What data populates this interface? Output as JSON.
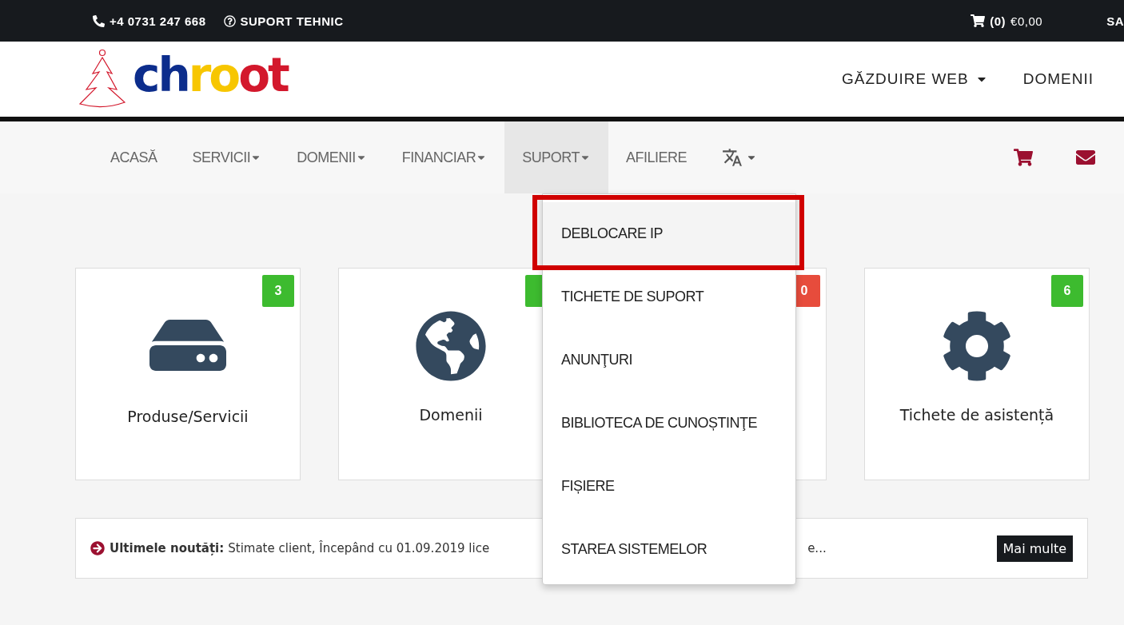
{
  "top_bar": {
    "phone": "+4 0731 247 668",
    "support": "SUPORT TEHNIC",
    "cart_count": "(0)",
    "cart_total": "€0,00",
    "cut_text": "SA"
  },
  "header": {
    "logo": [
      {
        "text": "ch",
        "color": "#0c2d8c"
      },
      {
        "text": "ro",
        "color": "#f7c600"
      },
      {
        "text": "ot",
        "color": "#d3182c"
      }
    ],
    "menu": [
      {
        "label": "GĂZDUIRE WEB",
        "dropdown": true
      },
      {
        "label": "DOMENII",
        "dropdown": false
      }
    ]
  },
  "nav": {
    "items": [
      {
        "label": "ACASĂ",
        "dropdown": false,
        "selected": false
      },
      {
        "label": "SERVICII",
        "dropdown": true,
        "selected": false
      },
      {
        "label": "DOMENII",
        "dropdown": true,
        "selected": false
      },
      {
        "label": "FINANCIAR",
        "dropdown": true,
        "selected": false
      },
      {
        "label": "SUPORT",
        "dropdown": true,
        "selected": true
      },
      {
        "label": "AFILIERE",
        "dropdown": false,
        "selected": false
      }
    ]
  },
  "dropdown": {
    "items": [
      {
        "label": "DEBLOCARE IP",
        "highlighted": true
      },
      {
        "label": "TICHETE DE SUPORT",
        "highlighted": false
      },
      {
        "label": "ANUNŢURI",
        "highlighted": false
      },
      {
        "label": "BIBLIOTECA DE CUNOȘTINŢE",
        "highlighted": false
      },
      {
        "label": "FIȘIERE",
        "highlighted": false
      },
      {
        "label": "STAREA SISTEMELOR",
        "highlighted": false
      }
    ]
  },
  "cards": [
    {
      "kind": "server",
      "title": "Produse/Servicii",
      "badge": "3",
      "color": "#3dbb2f"
    },
    {
      "kind": "globe",
      "title": "Domenii",
      "color": "#3dbb2f"
    },
    {
      "kind": "covered",
      "badge": "0",
      "color": "#e74c3c"
    },
    {
      "kind": "gear",
      "title": "Tichete de asistență",
      "badge": "6",
      "color": "#3dbb2f"
    }
  ],
  "news": {
    "label": "Ultimele noutăți:",
    "text_start": "Stimate client, Începând cu 01.09.2019 lice",
    "text_end": "e...",
    "button": "Mai multe"
  }
}
